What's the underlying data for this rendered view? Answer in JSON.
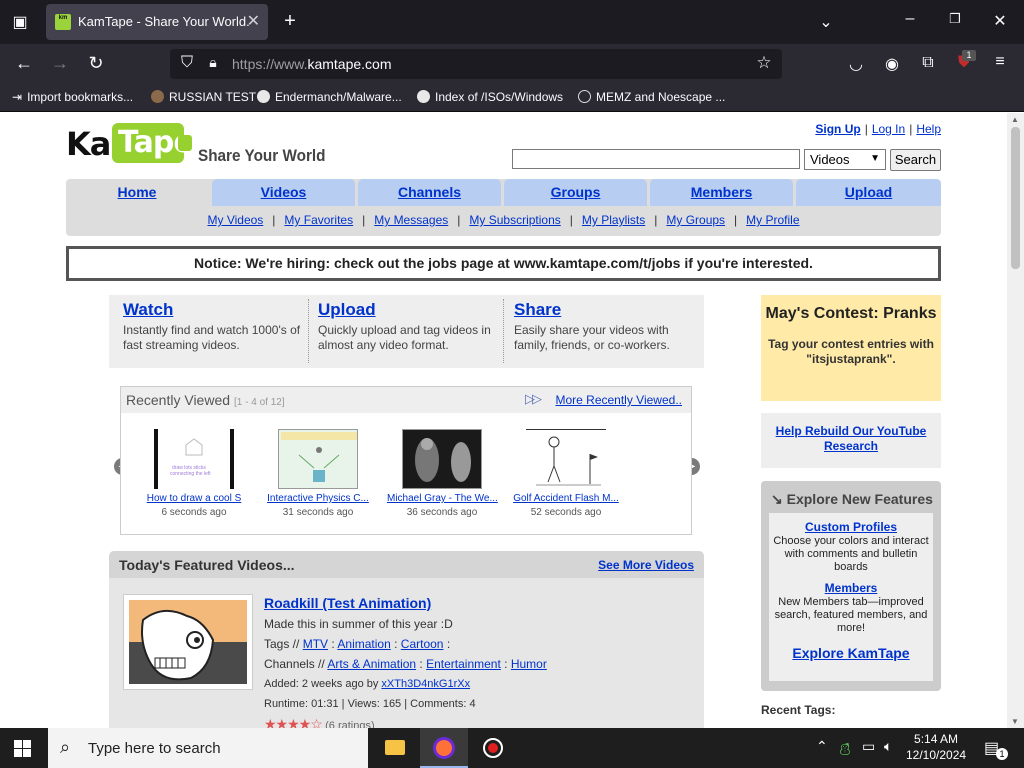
{
  "browser": {
    "tab_title": "KamTape - Share Your World.",
    "url_prefix": "https://www.",
    "url_domain": "kamtape.com",
    "bookmarks": [
      "Import bookmarks...",
      "RUSSIAN TEST",
      "Endermanch/Malware...",
      "Index of /ISOs/Windows",
      "MEMZ and Noescape ..."
    ],
    "ext_badge": "1"
  },
  "site": {
    "logo_left": "Kam",
    "logo_right": "Tape",
    "tagline": "Share Your World",
    "top_links": [
      "Sign Up",
      "Log In",
      "Help"
    ],
    "search": {
      "placeholder": "",
      "category": "Videos",
      "button": "Search"
    },
    "nav_tabs": [
      "Home",
      "Videos",
      "Channels",
      "Groups",
      "Members",
      "Upload"
    ],
    "sub_nav": [
      "My Videos",
      "My Favorites",
      "My Messages",
      "My Subscriptions",
      "My Playlists",
      "My Groups",
      "My Profile"
    ],
    "notice": "Notice: We're hiring: check out the jobs page at www.kamtape.com/t/jobs if you're interested.",
    "features": [
      {
        "title": "Watch",
        "desc": "Instantly find and watch 1000's of fast streaming videos."
      },
      {
        "title": "Upload",
        "desc": "Quickly upload and tag videos in almost any video format."
      },
      {
        "title": "Share",
        "desc": "Easily share your videos with family, friends, or co-workers."
      }
    ],
    "recently_viewed": {
      "title": "Recently Viewed",
      "range": "[1 - 4 of 12]",
      "more": "More Recently Viewed..",
      "items": [
        {
          "caption": "How to draw a cool S",
          "ago": "6 seconds ago"
        },
        {
          "caption": "Interactive Physics C...",
          "ago": "31 seconds ago"
        },
        {
          "caption": "Michael Gray - The We...",
          "ago": "36 seconds ago"
        },
        {
          "caption": "Golf Accident Flash M...",
          "ago": "52 seconds ago"
        }
      ]
    },
    "featured": {
      "title": "Today's Featured Videos...",
      "more": "See More Videos",
      "video": {
        "title": "Roadkill (Test Animation)",
        "desc": "Made this in summer of this year :D",
        "tags_label": "Tags //",
        "tags": [
          "MTV",
          "Animation",
          "Cartoon"
        ],
        "channels_label": "Channels //",
        "channels": [
          "Arts & Animation",
          "Entertainment",
          "Humor"
        ],
        "added_label": "Added: 2 weeks ago by",
        "author": "xXTh3D4nkG1rXx",
        "stats": "Runtime: 01:31 | Views: 165 | Comments: 4",
        "rating": 4.5,
        "ratings_text": "(6 ratings)"
      }
    },
    "sidebar": {
      "contest_title": "May's Contest: Pranks",
      "contest_desc": "Tag your contest entries with \"itsjustaprank\".",
      "rebuild_link": "Help Rebuild Our YouTube Research",
      "explore_title": "Explore New Features",
      "features": [
        {
          "title": "Custom Profiles",
          "desc": "Choose your colors and interact with comments and bulletin boards"
        },
        {
          "title": "Members",
          "desc": "New Members tab—improved search, featured members, and more!"
        }
      ],
      "explore_link": "Explore KamTape",
      "recent_tags": "Recent Tags:"
    }
  },
  "taskbar": {
    "search_text": "Type here to search",
    "time": "5:14 AM",
    "date": "12/10/2024",
    "notif_count": "1"
  }
}
